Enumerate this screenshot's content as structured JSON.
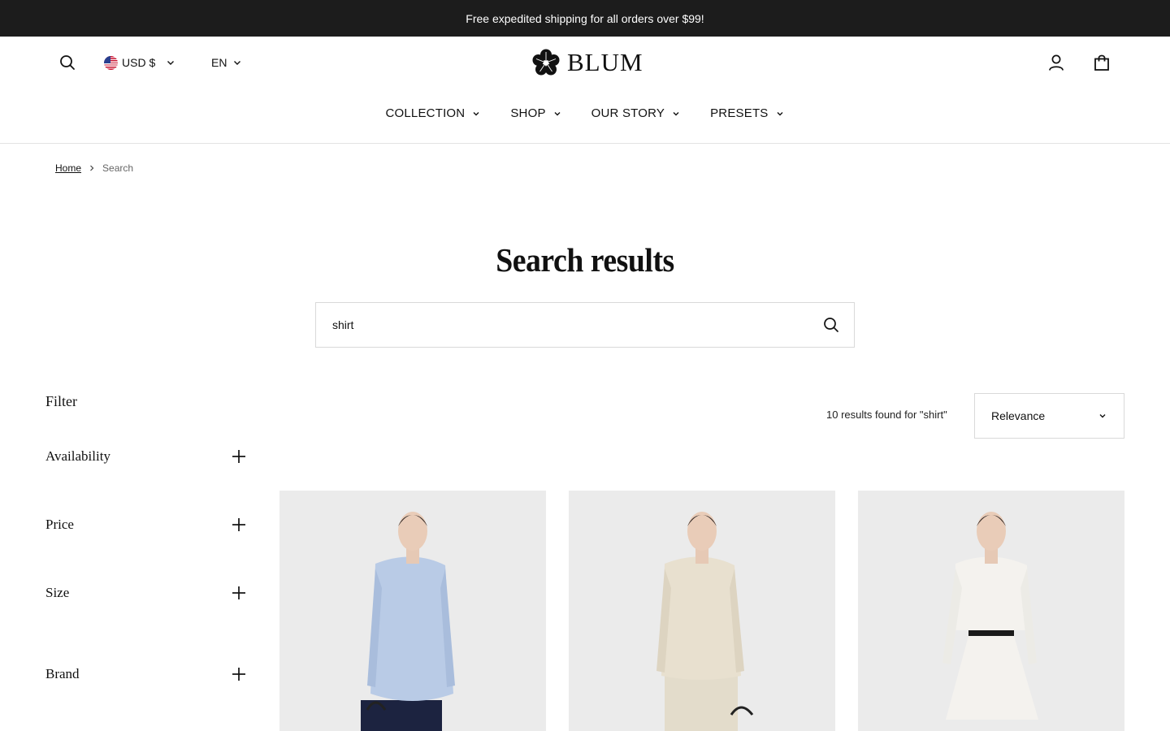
{
  "announcement": "Free expedited shipping for all orders over $99!",
  "header": {
    "currency": "USD $",
    "language": "EN",
    "logo_text": "BLUM"
  },
  "nav": [
    {
      "label": "COLLECTION"
    },
    {
      "label": "SHOP"
    },
    {
      "label": "OUR STORY"
    },
    {
      "label": "PRESETS"
    }
  ],
  "breadcrumb": {
    "home": "Home",
    "current": "Search"
  },
  "page_title": "Search results",
  "search": {
    "value": "shirt"
  },
  "filter": {
    "title": "Filter",
    "groups": [
      {
        "label": "Availability"
      },
      {
        "label": "Price"
      },
      {
        "label": "Size"
      },
      {
        "label": "Brand"
      }
    ]
  },
  "results": {
    "count_text": "10 results found for \"shirt\"",
    "sort_selected": "Relevance"
  },
  "products": [
    {
      "image": "model wearing blue striped shirt with navy skirt",
      "shirt_color": "#b9cbe6",
      "bottom_color": "#1c2340"
    },
    {
      "image": "model wearing beige shirt with beige skirt",
      "shirt_color": "#e8e0cf",
      "bottom_color": "#e3dccb"
    },
    {
      "image": "model wearing white shirt dress with black belt",
      "shirt_color": "#f4f2ee",
      "bottom_color": "#f4f2ee"
    }
  ]
}
